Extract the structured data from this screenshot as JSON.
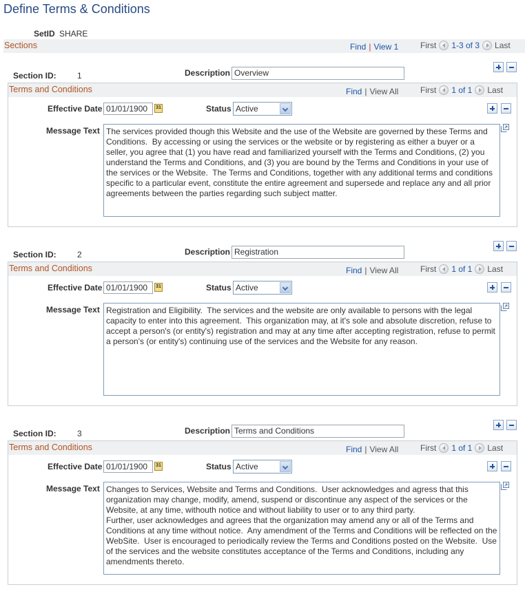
{
  "page": {
    "title": "Define Terms & Conditions",
    "setid_label": "SetID",
    "setid_value": "SHARE"
  },
  "sections_grid": {
    "title": "Sections",
    "find": "Find",
    "separator": "|",
    "view": "View 1",
    "first": "First",
    "range": "1-3 of 3",
    "last": "Last"
  },
  "labels": {
    "section_id": "Section ID:",
    "description": "Description",
    "terms_title": "Terms and Conditions",
    "effective_date": "Effective Date",
    "status": "Status",
    "message_text": "Message Text",
    "find": "Find",
    "separator": "|",
    "view_all": "View All",
    "first": "First",
    "last": "Last",
    "calendar_glyph": "31"
  },
  "sections": [
    {
      "id": "1",
      "description": "Overview",
      "range": "1 of 1",
      "effective_date": "01/01/1900",
      "status": "Active",
      "message_text": "The services provided though this Website and the use of the Website are governed by these Terms and Conditions.  By accessing or using the services or the website or by registering as either a buyer or a seller, you agree that (1) you have read and familiarized yourself with the Terms and Conditions, (2) you understand the Terms and Conditions, and (3) you are bound by the Terms and Conditions in your use of the services or the Website.  The Terms and Conditions, together with any additional terms and conditions specific to a particular event, constitute the entire agreement and supersede and replace any and all prior agreements between the parties regarding such subject matter."
    },
    {
      "id": "2",
      "description": "Registration",
      "range": "1 of 1",
      "effective_date": "01/01/1900",
      "status": "Active",
      "message_text": "Registration and Eligibility.  The services and the website are only available to persons with the legal capacity to enter into this agreement.  This organization may, at it's sole and absolute discretion, refuse to accept a person's (or entity's) registration and may at any time after accepting registration, refuse to permit a person's (or entity's) continuing use of the services and the Website for any reason."
    },
    {
      "id": "3",
      "description": "Terms and Conditions",
      "range": "1 of 1",
      "effective_date": "01/01/1900",
      "status": "Active",
      "message_text": "Changes to Services, Website and Terms and Conditions.  User acknowledges and agress that this organization may change, modify, amend, suspend or discontinue any aspect of the services or the Website, at any time, withouth notice and without liability to user or to any third party.\nFurther, user acknowledges and agrees that the organization may amend any or all of the Terms and Conditions at any time without notice.  Any amendment of the Terms and Conditions will be reflected on the WebSite.  User is encouraged to periodically review the Terms and Conditions posted on the Website.  Use of the services and the website constitutes acceptance of the Terms and Conditions, including any amendments thereto."
    }
  ]
}
